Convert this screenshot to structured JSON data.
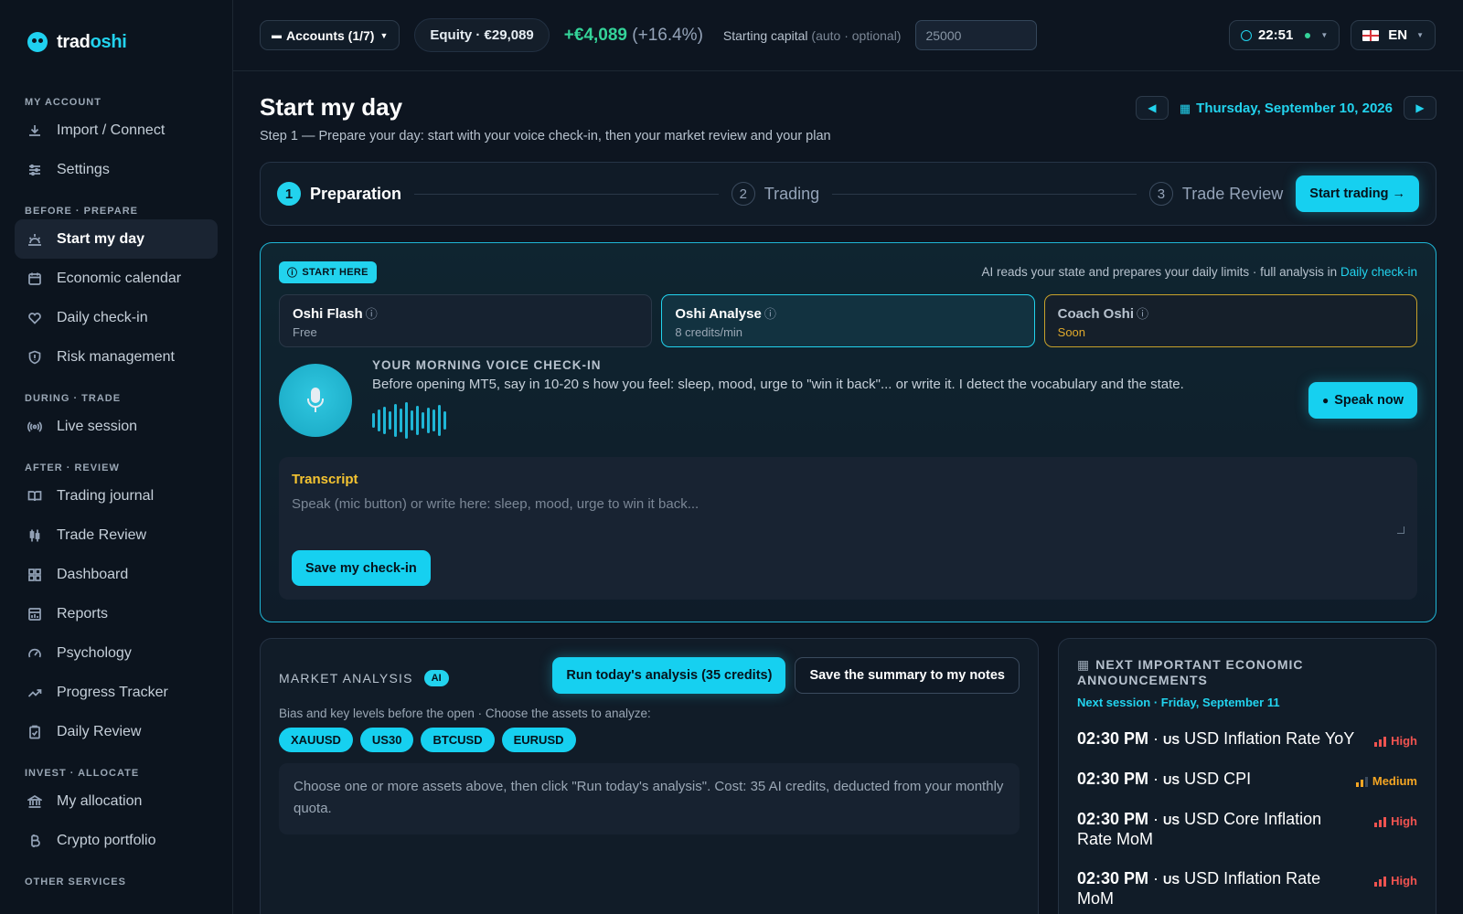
{
  "brand": {
    "prefix": "trad",
    "suffix": "oshi"
  },
  "sidebar": {
    "sections": [
      {
        "title": "MY ACCOUNT",
        "items": [
          {
            "label": "Import / Connect",
            "icon": "download-icon"
          },
          {
            "label": "Settings",
            "icon": "sliders-icon"
          }
        ]
      },
      {
        "title": "BEFORE · PREPARE",
        "items": [
          {
            "label": "Start my day",
            "icon": "sunrise-icon",
            "active": true
          },
          {
            "label": "Economic calendar",
            "icon": "calendar-icon"
          },
          {
            "label": "Daily check-in",
            "icon": "heart-icon"
          },
          {
            "label": "Risk management",
            "icon": "shield-icon"
          }
        ]
      },
      {
        "title": "DURING · TRADE",
        "items": [
          {
            "label": "Live session",
            "icon": "broadcast-icon"
          }
        ]
      },
      {
        "title": "AFTER · REVIEW",
        "items": [
          {
            "label": "Trading journal",
            "icon": "book-icon"
          },
          {
            "label": "Trade Review",
            "icon": "candles-icon"
          },
          {
            "label": "Dashboard",
            "icon": "grid-icon"
          },
          {
            "label": "Reports",
            "icon": "report-icon"
          },
          {
            "label": "Psychology",
            "icon": "gauge-icon"
          },
          {
            "label": "Progress Tracker",
            "icon": "trend-icon"
          },
          {
            "label": "Daily Review",
            "icon": "clipboard-icon"
          }
        ]
      },
      {
        "title": "INVEST · ALLOCATE",
        "items": [
          {
            "label": "My allocation",
            "icon": "bank-icon"
          },
          {
            "label": "Crypto portfolio",
            "icon": "bitcoin-icon"
          }
        ]
      },
      {
        "title": "OTHER SERVICES",
        "items": []
      }
    ]
  },
  "topbar": {
    "accounts": "Accounts (1/7)",
    "equity": "Equity · €29,089",
    "pnl_value": "+€4,089",
    "pnl_pct": "(+16.4%)",
    "capital_label": "Starting capital",
    "capital_hint": "(auto · optional)",
    "capital_value": "25000",
    "time": "22:51",
    "lang": "EN"
  },
  "page": {
    "title": "Start my day",
    "subtitle": "Step 1 — Prepare your day: start with your voice check-in, then your market review and your plan",
    "date": "Thursday, September 10, 2026"
  },
  "stepper": {
    "steps": [
      {
        "num": "1",
        "label": "Preparation"
      },
      {
        "num": "2",
        "label": "Trading"
      },
      {
        "num": "3",
        "label": "Trade Review"
      }
    ],
    "cta": "Start trading →"
  },
  "checkin": {
    "badge": "START HERE",
    "ai_note": "AI reads your state and prepares your daily limits · full analysis in",
    "ai_link": "Daily check-in",
    "modes": [
      {
        "name": "Oshi Flash",
        "sub": "Free"
      },
      {
        "name": "Oshi Analyse",
        "sub": "8 credits/min"
      },
      {
        "name": "Coach Oshi",
        "sub": "Soon"
      }
    ],
    "voice_title": "YOUR MORNING VOICE CHECK-IN",
    "voice_desc": "Before opening MT5, say in 10-20 s how you feel: sleep, mood, urge to \"win it back\"... or write it. I detect the vocabulary and the state.",
    "speak_label": "Speak now",
    "transcript_label": "Transcript",
    "transcript_placeholder": "Speak (mic button) or write here: sleep, mood, urge to win it back...",
    "save_label": "Save my check-in"
  },
  "market": {
    "title": "MARKET ANALYSIS",
    "ai_tag": "AI",
    "run_label": "Run today's analysis (35 credits)",
    "save_label": "Save the summary to my notes",
    "subtitle": "Bias and key levels before the open · Choose the assets to analyze:",
    "assets": [
      "XAUUSD",
      "US30",
      "BTCUSD",
      "EURUSD"
    ],
    "info": "Choose one or more assets above, then click \"Run today's analysis\". Cost: 35 AI credits, deducted from your monthly quota."
  },
  "economic": {
    "title": "NEXT IMPORTANT ECONOMIC ANNOUNCEMENTS",
    "subtitle": "Next session · Friday, September 11",
    "events": [
      {
        "time": "02:30 PM",
        "cc": "US",
        "name": "USD Inflation Rate YoY",
        "impact": "High",
        "color": "#ef5350",
        "level": 3
      },
      {
        "time": "02:30 PM",
        "cc": "US",
        "name": "USD CPI",
        "impact": "Medium",
        "color": "#f5a623",
        "level": 2
      },
      {
        "time": "02:30 PM",
        "cc": "US",
        "name": "USD Core Inflation Rate MoM",
        "impact": "High",
        "color": "#ef5350",
        "level": 3
      },
      {
        "time": "02:30 PM",
        "cc": "US",
        "name": "USD Inflation Rate MoM",
        "impact": "High",
        "color": "#ef5350",
        "level": 3
      }
    ]
  }
}
